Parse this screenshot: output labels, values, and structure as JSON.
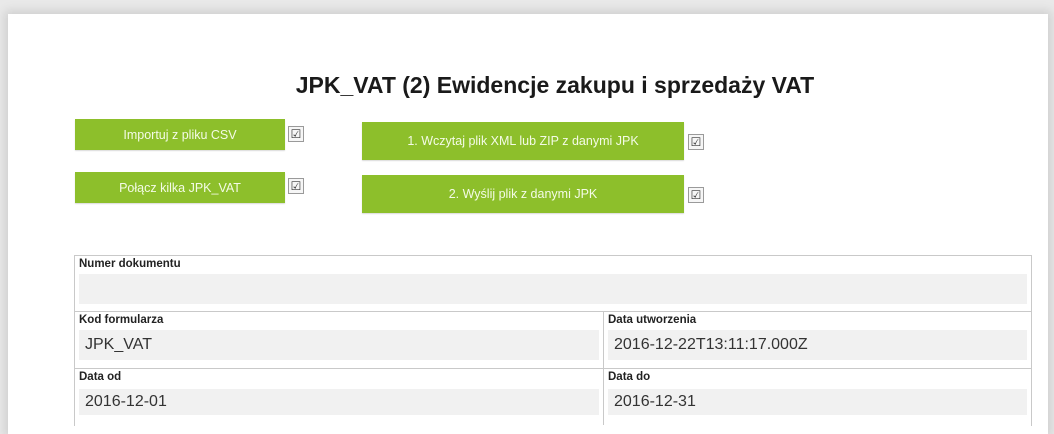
{
  "page": {
    "title": "JPK_VAT (2) Ewidencje zakupu i sprzedaży VAT"
  },
  "actions": {
    "import_csv": "Importuj z pliku CSV",
    "merge": "Połącz kilka JPK_VAT",
    "load_xml": "1. Wczytaj plik XML lub ZIP z danymi JPK",
    "send": "2. Wyślij plik z danymi JPK",
    "accent_color": "#8dbf2b",
    "check_glyph": "☑"
  },
  "form": {
    "numer_dokumentu": {
      "label": "Numer dokumentu",
      "value": ""
    },
    "kod_formularza": {
      "label": "Kod formularza",
      "value": "JPK_VAT"
    },
    "data_utworzenia": {
      "label": "Data utworzenia",
      "value": "2016-12-22T13:11:17.000Z"
    },
    "data_od": {
      "label": "Data od",
      "value": "2016-12-01"
    },
    "data_do": {
      "label": "Data do",
      "value": "2016-12-31"
    }
  }
}
